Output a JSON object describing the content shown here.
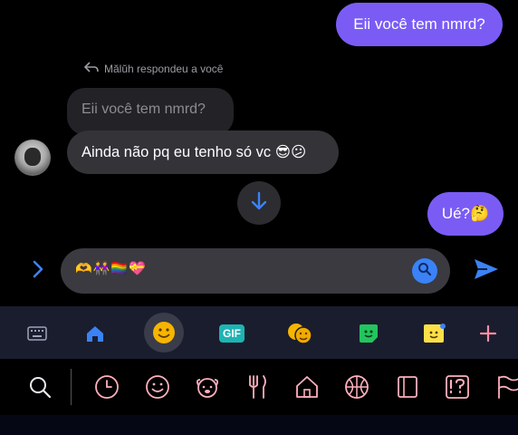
{
  "messages": {
    "outgoing_1": "Eii você tem nmrd?",
    "reply_indicator": "Mălŭh respondeu a você",
    "quoted_text": "Eii você tem nmrd?",
    "incoming_text": "Ainda não pq eu tenho só vc 😎😕",
    "outgoing_2": "Ué?🤔"
  },
  "composer": {
    "text": "🫶👭🏳️‍🌈💝"
  },
  "keyboard_toolbar": {
    "items": [
      "keyboard-icon",
      "home-icon",
      "emoji-icon",
      "gif-button",
      "theater-masks-icon",
      "sticker-icon",
      "sticky-note-icon",
      "plus-icon"
    ],
    "active": "emoji-icon",
    "gif_label": "GIF"
  },
  "emoji_categories": {
    "items": [
      "search",
      "recent",
      "smileys",
      "animals",
      "food",
      "travel",
      "activities",
      "objects",
      "symbols",
      "flags"
    ]
  },
  "colors": {
    "outgoing_bubble": "#7a5cf5",
    "incoming_bubble": "#333338",
    "accent_blue": "#3b82f6",
    "toolbar_bg": "#1a1d2e",
    "category_icon": "#ffb0bd"
  }
}
